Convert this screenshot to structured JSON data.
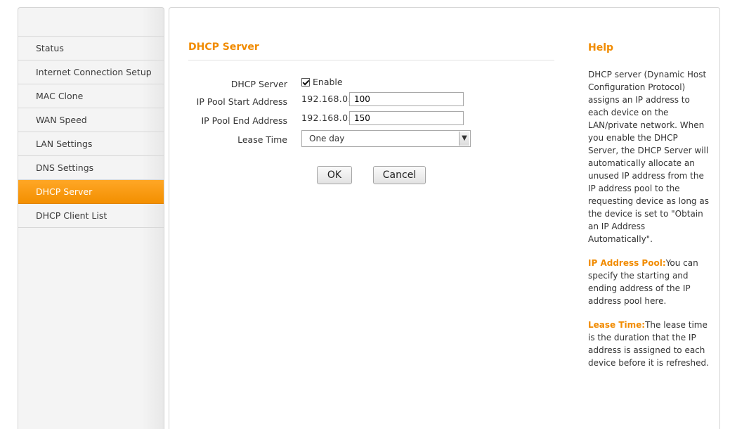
{
  "sidebar": {
    "items": [
      {
        "label": "Status"
      },
      {
        "label": "Internet Connection Setup"
      },
      {
        "label": "MAC Clone"
      },
      {
        "label": "WAN Speed"
      },
      {
        "label": "LAN Settings"
      },
      {
        "label": "DNS Settings"
      },
      {
        "label": "DHCP Server",
        "active": true
      },
      {
        "label": "DHCP Client List"
      }
    ],
    "active_color": "#f39200"
  },
  "main": {
    "title": "DHCP Server",
    "form": {
      "dhcp_server_label": "DHCP Server",
      "enable_label": "Enable",
      "enable_checked": true,
      "pool_start_label": "IP Pool Start Address",
      "pool_start_prefix": "192.168.0.",
      "pool_start_value": "100",
      "pool_end_label": "IP Pool End Address",
      "pool_end_prefix": "192.168.0.",
      "pool_end_value": "150",
      "lease_time_label": "Lease Time",
      "lease_time_value": "One day"
    },
    "buttons": {
      "ok_label": "OK",
      "cancel_label": "Cancel"
    }
  },
  "help": {
    "title": "Help",
    "intro": "DHCP server (Dynamic Host Configuration Protocol) assigns an IP address to each device on the LAN/private network. When you enable the DHCP Server, the DHCP Server will automatically allocate an unused IP address from the IP address pool to the requesting device as long as the device is set to \"Obtain an IP Address Automatically\".",
    "pool_term": "IP Address Pool:",
    "pool_text": "You can specify the starting and ending address of the IP address pool here.",
    "lease_term": "Lease Time:",
    "lease_text": "The lease time is the duration that the IP address is assigned to each device before it is refreshed."
  },
  "colors": {
    "accent": "#f18b00"
  }
}
